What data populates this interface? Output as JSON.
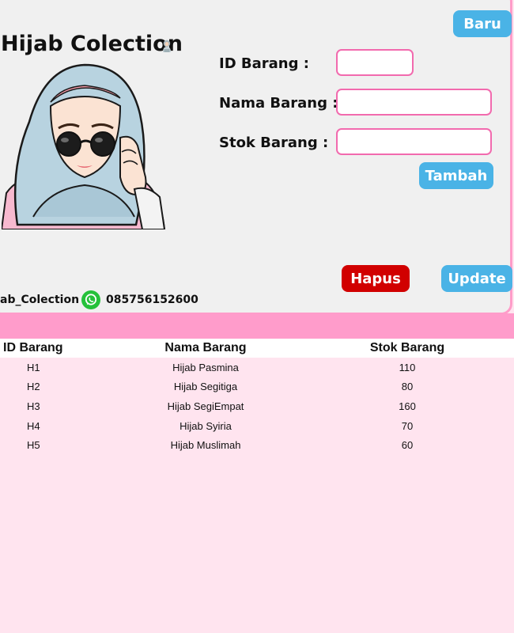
{
  "app": {
    "title": "Hijab Colection",
    "title_icon": "hijab-figure-icon",
    "avatar_icon": "hijab-girl-sunglasses-avatar"
  },
  "form": {
    "id_label": "ID Barang :",
    "id_value": "",
    "nama_label": "Nama Barang :",
    "nama_value": "",
    "stok_label": "Stok Barang :",
    "stok_value": ""
  },
  "buttons": {
    "baru": "Baru",
    "tambah": "Tambah",
    "hapus": "Hapus",
    "update": "Update"
  },
  "footer": {
    "handle": "ab_Colection",
    "phone": "085756152600",
    "whatsapp_icon": "whatsapp-icon"
  },
  "table": {
    "columns": [
      "ID Barang",
      "Nama Barang",
      "Stok Barang"
    ],
    "rows": [
      [
        "H1",
        "Hijab Pasmina",
        "110"
      ],
      [
        "H2",
        "Hijab Segitiga",
        "80"
      ],
      [
        "H3",
        "Hijab SegiEmpat",
        "160"
      ],
      [
        "H4",
        "Hijab Syiria",
        "70"
      ],
      [
        "H5",
        "Hijab Muslimah",
        "60"
      ]
    ]
  },
  "colors": {
    "panel_bg": "#f0f0f0",
    "page_bg": "#ffe4ef",
    "band": "#ff9ccb",
    "input_border": "#f26aae",
    "button_blue": "#4ab3e6",
    "button_red": "#d10000",
    "whatsapp": "#25c13a"
  }
}
